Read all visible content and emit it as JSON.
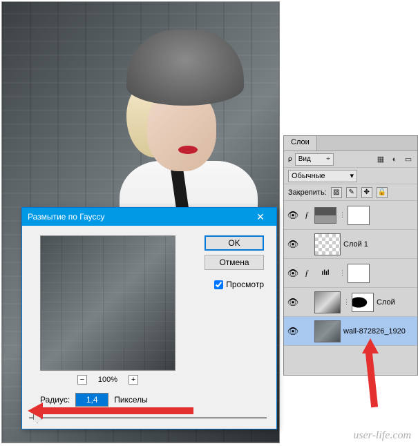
{
  "dialog": {
    "title": "Размытие по Гауссу",
    "close": "✕",
    "ok": "OK",
    "cancel": "Отмена",
    "preview_label": "Просмотр",
    "zoom_minus": "−",
    "zoom_plus": "+",
    "zoom_value": "100%",
    "radius_label": "Радиус:",
    "radius_value": "1,4",
    "radius_unit": "Пикселы"
  },
  "panel": {
    "tab": "Слои",
    "filter_label": "Вид",
    "filter_caret": "÷",
    "blend_mode": "Обычные",
    "caret": "▾",
    "lock_label": "Закрепить:",
    "icons": {
      "img": "▦",
      "fx": "⬙",
      "adj": "◐",
      "mask": "▭"
    },
    "lock_icons": {
      "pix": "▨",
      "brush": "✎",
      "move": "✥",
      "all": "🔒"
    }
  },
  "layers": [
    {
      "vis": "👁",
      "fx": "ƒ",
      "name": "",
      "type": "group"
    },
    {
      "vis": "👁",
      "name": "Слой 1",
      "type": "checker"
    },
    {
      "vis": "👁",
      "fx": "ƒ",
      "adj": "ılıl",
      "name": "",
      "type": "adj"
    },
    {
      "vis": "👁",
      "name": "Слой",
      "type": "bw"
    },
    {
      "vis": "👁",
      "name": "wall-872826_1920",
      "type": "wall",
      "selected": true
    }
  ],
  "watermark": "user-life.com"
}
